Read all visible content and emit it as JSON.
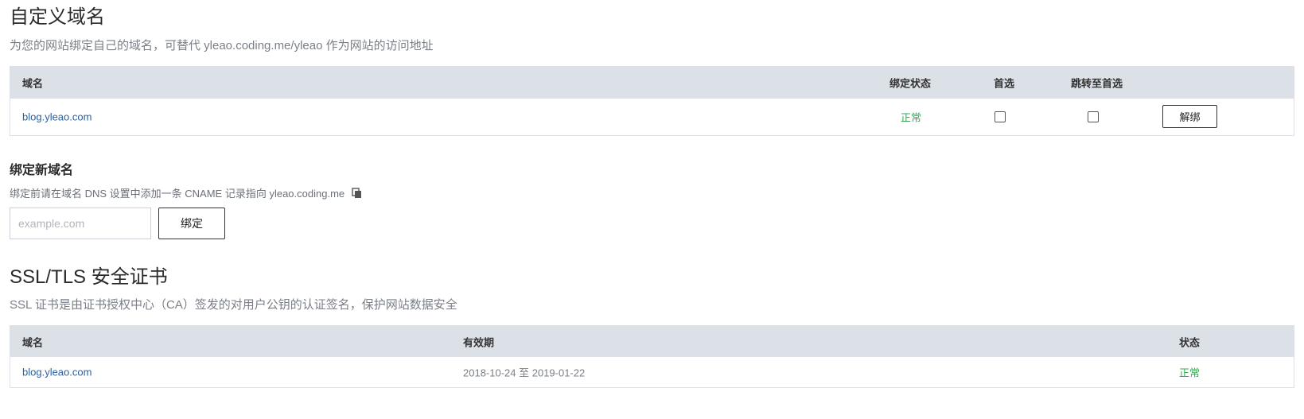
{
  "custom_domain": {
    "title": "自定义域名",
    "subtitle": "为您的网站绑定自己的域名，可替代 yleao.coding.me/yleao 作为网站的访问地址",
    "table": {
      "headers": {
        "domain": "域名",
        "bind_status": "绑定状态",
        "preferred": "首选",
        "redirect": "跳转至首选"
      },
      "rows": [
        {
          "domain": "blog.yleao.com",
          "status": "正常",
          "preferred": false,
          "redirect": false,
          "action": "解绑"
        }
      ]
    }
  },
  "bind_new": {
    "title": "绑定新域名",
    "hint": "绑定前请在域名 DNS 设置中添加一条 CNAME 记录指向 yleao.coding.me",
    "input_placeholder": "example.com",
    "input_value": "",
    "button": "绑定"
  },
  "ssl": {
    "title": "SSL/TLS 安全证书",
    "subtitle": "SSL 证书是由证书授权中心（CA）签发的对用户公钥的认证签名，保护网站数据安全",
    "table": {
      "headers": {
        "domain": "域名",
        "validity": "有效期",
        "status": "状态"
      },
      "rows": [
        {
          "domain": "blog.yleao.com",
          "validity": "2018-10-24 至 2019-01-22",
          "status": "正常"
        }
      ]
    }
  },
  "colors": {
    "link": "#2a5f9e",
    "success": "#3aa757",
    "table_header_bg": "#dce0e7"
  },
  "icons": {
    "copy": "copy-icon"
  }
}
